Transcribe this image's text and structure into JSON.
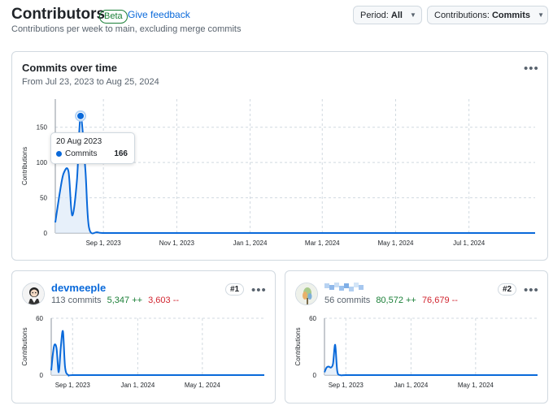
{
  "header": {
    "title": "Contributors",
    "beta_label": "Beta",
    "feedback_label": "Give feedback",
    "subtitle": "Contributions per week to main, excluding merge commits"
  },
  "controls": {
    "period_prefix": "Period:",
    "period_value": "All",
    "contrib_prefix": "Contributions:",
    "contrib_value": "Commits"
  },
  "main_chart": {
    "title": "Commits over time",
    "range": "From Jul 23, 2023 to Aug 25, 2024",
    "tooltip": {
      "date": "20 Aug 2023",
      "label": "Commits",
      "value": "166"
    }
  },
  "contributors": [
    {
      "name": "devmeeple",
      "rank": "#1",
      "commits": "113 commits",
      "additions": "5,347 ++",
      "deletions": "3,603 --"
    },
    {
      "name": "",
      "rank": "#2",
      "commits": "56 commits",
      "additions": "80,572 ++",
      "deletions": "76,679 --"
    }
  ],
  "colors": {
    "accent": "#0969da",
    "additions": "#1a7f37",
    "deletions": "#d1242f",
    "area_fill": "#ddeaf8"
  },
  "chart_data": [
    {
      "type": "area",
      "title": "Commits over time",
      "ylabel": "Contributions",
      "ylim": [
        0,
        190
      ],
      "yticks": [
        0,
        50,
        100,
        150
      ],
      "x_tick_labels": [
        "Sep 1, 2023",
        "Nov 1, 2023",
        "Jan 1, 2024",
        "Mar 1, 2024",
        "May 1, 2024",
        "Jul 1, 2024"
      ],
      "x_ticks_days": [
        40,
        101,
        162,
        222,
        283,
        344
      ],
      "x_range_days": [
        0,
        399
      ],
      "series": [
        {
          "x_days": [
            0,
            4,
            7,
            11,
            14,
            18,
            21,
            25,
            28,
            35,
            42,
            60,
            120,
            200,
            300,
            399
          ],
          "values": [
            15,
            60,
            85,
            87,
            25,
            75,
            166,
            90,
            8,
            1,
            0,
            0,
            0,
            0,
            0,
            0
          ]
        }
      ]
    },
    {
      "type": "area",
      "ylabel": "Contributions",
      "ylim": [
        0,
        60
      ],
      "yticks": [
        0,
        60
      ],
      "x_tick_labels": [
        "Sep 1, 2023",
        "Jan 1, 2024",
        "May 1, 2024"
      ],
      "x_ticks_days": [
        40,
        162,
        283
      ],
      "x_range_days": [
        0,
        399
      ],
      "series": [
        {
          "x_days": [
            0,
            3,
            6,
            10,
            14,
            18,
            22,
            26,
            32,
            40,
            100,
            399
          ],
          "values": [
            5,
            22,
            32,
            28,
            3,
            30,
            46,
            8,
            0,
            0,
            0,
            0
          ]
        }
      ]
    },
    {
      "type": "area",
      "ylabel": "Contributions",
      "ylim": [
        0,
        60
      ],
      "yticks": [
        0,
        60
      ],
      "x_tick_labels": [
        "Sep 1, 2023",
        "Jan 1, 2024",
        "May 1, 2024"
      ],
      "x_ticks_days": [
        40,
        162,
        283
      ],
      "x_range_days": [
        0,
        399
      ],
      "series": [
        {
          "x_days": [
            0,
            4,
            8,
            12,
            16,
            20,
            24,
            30,
            40,
            100,
            399
          ],
          "values": [
            3,
            8,
            9,
            8,
            12,
            32,
            4,
            0,
            0,
            0,
            0
          ]
        }
      ]
    }
  ]
}
